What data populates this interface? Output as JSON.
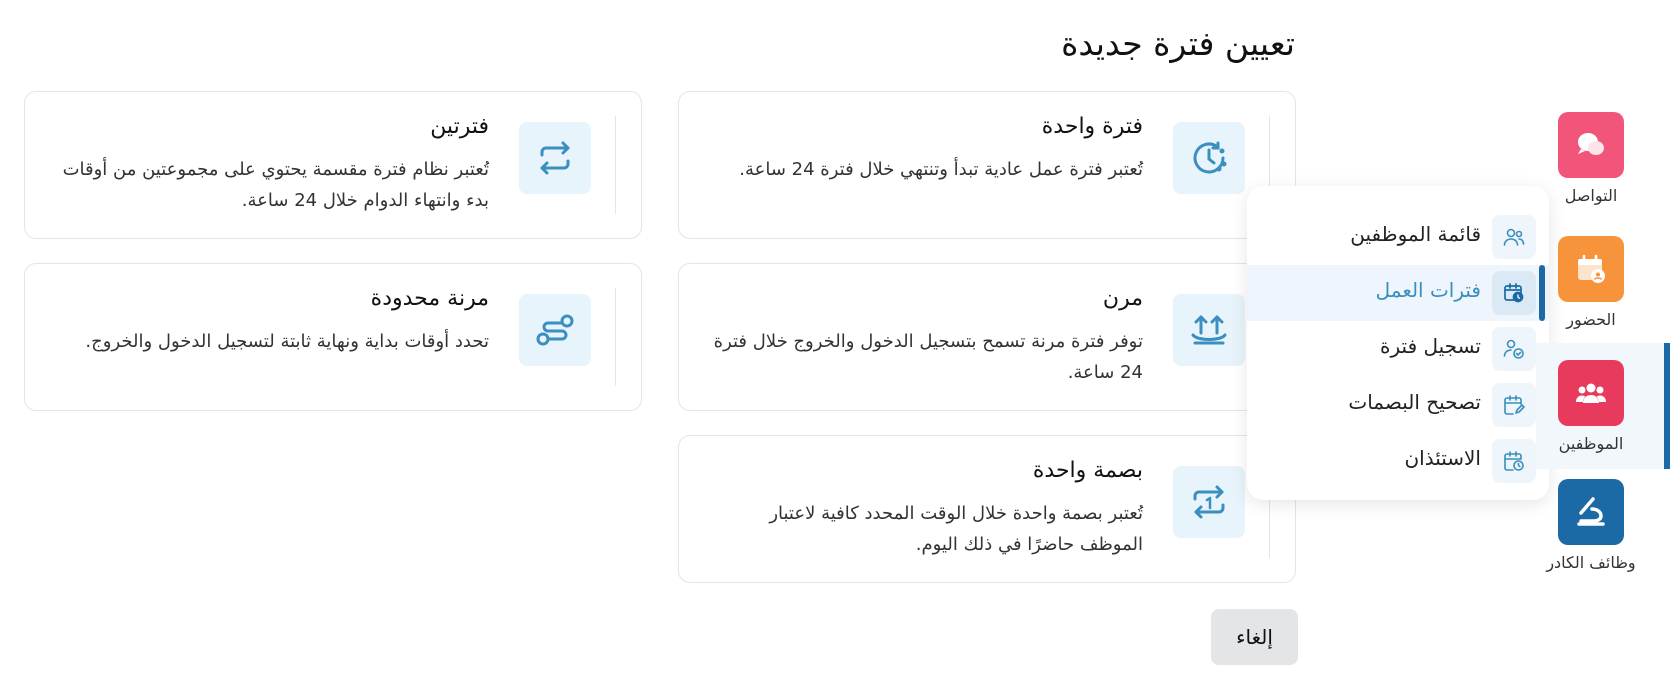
{
  "modal": {
    "title": "تعيين فترة جديدة",
    "cards": [
      {
        "title": "فترة واحدة",
        "description": "تُعتبر فترة عمل عادية تبدأ وتنتهي خلال فترة 24 ساعة.",
        "icon": "clock-icon"
      },
      {
        "title": "فترتين",
        "description": "تُعتبر نظام فترة مقسمة يحتوي على مجموعتين من أوقات بدء وانتهاء الدوام خلال 24 ساعة.",
        "icon": "swap-arrows-icon"
      },
      {
        "title": "مرن",
        "description": "توفر فترة مرنة تسمح بتسجيل الدخول والخروج خلال فترة 24 ساعة.",
        "icon": "flex-arrows-icon"
      },
      {
        "title": "مرنة محدودة",
        "description": "تحدد أوقات بداية ونهاية ثابتة لتسجيل الدخول والخروج.",
        "icon": "route-icon"
      },
      {
        "title": "بصمة واحدة",
        "description": "تُعتبر بصمة واحدة خلال الوقت المحدد كافية لاعتبار الموظف حاضرًا في ذلك اليوم.",
        "icon": "single-punch-icon"
      }
    ],
    "cancel_label": "إلغاء"
  },
  "dropdown": {
    "items": [
      {
        "label": "قائمة الموظفين",
        "icon": "users-icon",
        "active": false
      },
      {
        "label": "فترات العمل",
        "icon": "calendar-clock-icon",
        "active": true
      },
      {
        "label": "تسجيل فترة",
        "icon": "user-check-icon",
        "active": false
      },
      {
        "label": "تصحيح البصمات",
        "icon": "calendar-edit-icon",
        "active": false
      },
      {
        "label": "الاستئذان",
        "icon": "calendar-timer-icon",
        "active": false
      }
    ]
  },
  "rail": {
    "items": [
      {
        "label": "التواصل",
        "icon": "chat-icon",
        "color": "#f2557a"
      },
      {
        "label": "الحضور",
        "icon": "attendance-icon",
        "color": "#f7933a"
      },
      {
        "label": "الموظفين",
        "icon": "employees-icon",
        "color": "#e83a5c"
      },
      {
        "label": "وظائف الكادر",
        "icon": "cadre-jobs-icon",
        "color": "#1b6aa5"
      }
    ]
  },
  "colors": {
    "accent": "#3a8fbf",
    "primary": "#1b6aa5",
    "icon_bg": "#e8f4fb"
  }
}
